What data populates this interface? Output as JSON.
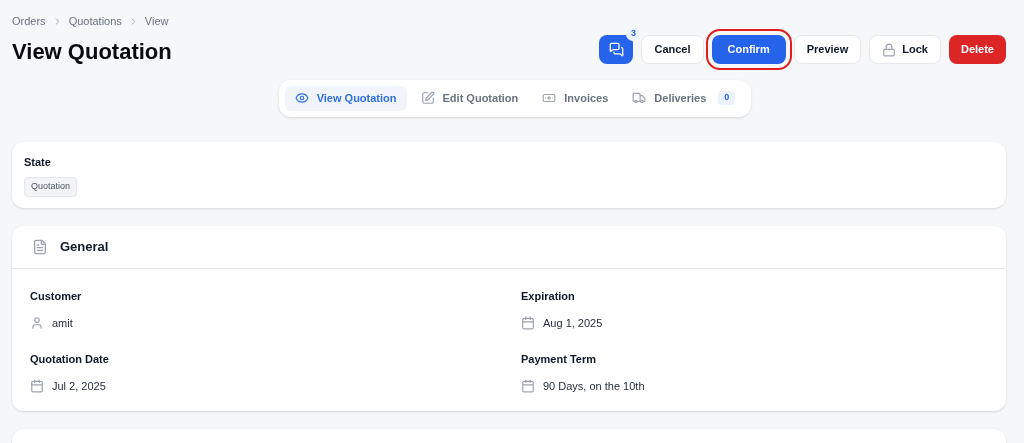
{
  "breadcrumb": [
    "Orders",
    "Quotations",
    "View"
  ],
  "title": "View Quotation",
  "actions": [
    {
      "kind": "chat",
      "badge": "3",
      "highlighted": false
    },
    {
      "kind": "outline",
      "label": "Cancel",
      "highlighted": false
    },
    {
      "kind": "primary",
      "label": "Confirm",
      "highlighted": true
    },
    {
      "kind": "outline",
      "label": "Preview",
      "highlighted": false
    },
    {
      "kind": "lock",
      "label": "Lock",
      "highlighted": false
    },
    {
      "kind": "danger",
      "label": "Delete",
      "highlighted": false
    }
  ],
  "tabs": [
    {
      "kind": "eye",
      "label": "View Quotation",
      "selected": true
    },
    {
      "kind": "pencil",
      "label": "Edit Quotation",
      "selected": false
    },
    {
      "kind": "invoice",
      "label": "Invoices",
      "selected": false
    },
    {
      "kind": "truck",
      "label": "Deliveries",
      "selected": false,
      "count": "0"
    }
  ],
  "state": {
    "label": "State",
    "value": "Quotation"
  },
  "general": {
    "title": "General",
    "fields": [
      {
        "kind": "user",
        "label": "Customer",
        "value": "amit"
      },
      {
        "kind": "calendar",
        "label": "Expiration",
        "value": "Aug 1, 2025"
      },
      {
        "kind": "calendar",
        "label": "Quotation Date",
        "value": "Jul 2, 2025"
      },
      {
        "kind": "calendar",
        "label": "Payment Term",
        "value": "90 Days, on the 10th"
      }
    ]
  }
}
